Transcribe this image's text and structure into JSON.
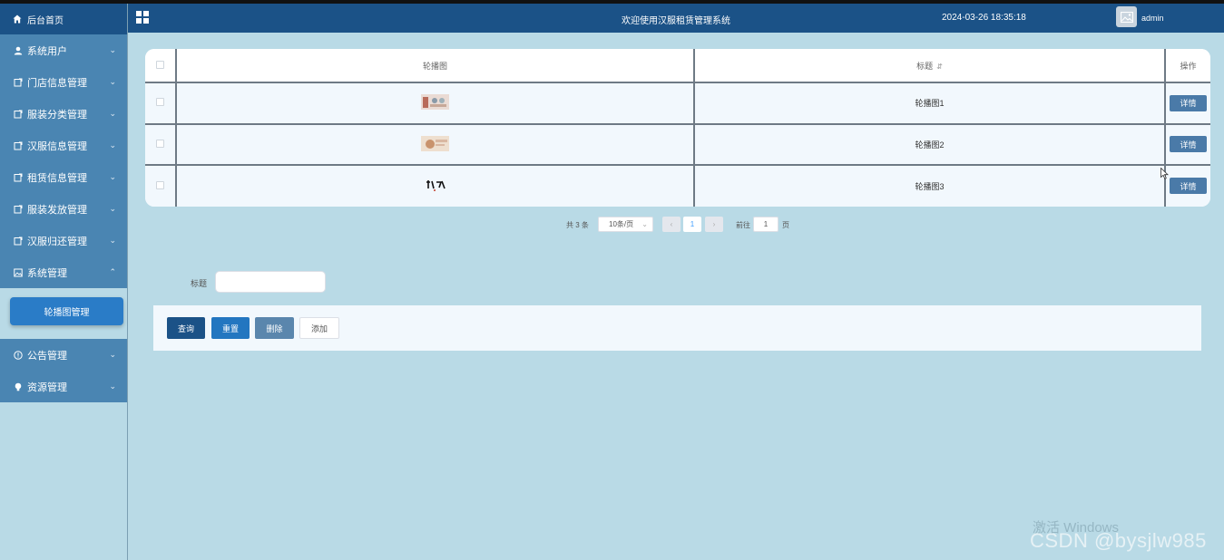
{
  "header": {
    "title": "欢迎使用汉服租赁管理系统",
    "datetime": "2024-03-26 18:35:18",
    "username": "admin"
  },
  "sidebar": {
    "home": "后台首页",
    "items": [
      {
        "label": "系统用户",
        "icon": "user-icon",
        "expanded": false
      },
      {
        "label": "门店信息管理",
        "icon": "doc-icon",
        "expanded": false
      },
      {
        "label": "服装分类管理",
        "icon": "doc-icon",
        "expanded": false
      },
      {
        "label": "汉服信息管理",
        "icon": "doc-icon",
        "expanded": false
      },
      {
        "label": "租赁信息管理",
        "icon": "doc-icon",
        "expanded": false
      },
      {
        "label": "服装发放管理",
        "icon": "doc-icon",
        "expanded": false
      },
      {
        "label": "汉服归还管理",
        "icon": "doc-icon",
        "expanded": false
      },
      {
        "label": "系统管理",
        "icon": "image-icon",
        "expanded": true
      },
      {
        "label": "公告管理",
        "icon": "info-icon",
        "expanded": false
      },
      {
        "label": "资源管理",
        "icon": "bulb-icon",
        "expanded": false
      }
    ],
    "sub_active": "轮播图管理"
  },
  "table": {
    "columns": [
      "轮播图",
      "标题",
      "操作"
    ],
    "rows": [
      {
        "title": "轮播图1",
        "action": "详情"
      },
      {
        "title": "轮播图2",
        "action": "详情"
      },
      {
        "title": "轮播图3",
        "action": "详情"
      }
    ]
  },
  "pagination": {
    "total": "共 3 条",
    "page_size": "10条/页",
    "current": "1",
    "goto_label": "前往",
    "goto_value": "1",
    "page_suffix": "页"
  },
  "search": {
    "label": "标题",
    "value": ""
  },
  "actions": {
    "query": "查询",
    "reset": "重置",
    "delete": "删除",
    "add": "添加"
  },
  "overlay": {
    "windows": "激活 Windows",
    "csdn": "CSDN @bysjlw985"
  },
  "colors": {
    "header": "#1b5287",
    "sidebar_menu": "#4a85b2",
    "background": "#b9dae6",
    "active_sub": "#2a7cc7"
  }
}
